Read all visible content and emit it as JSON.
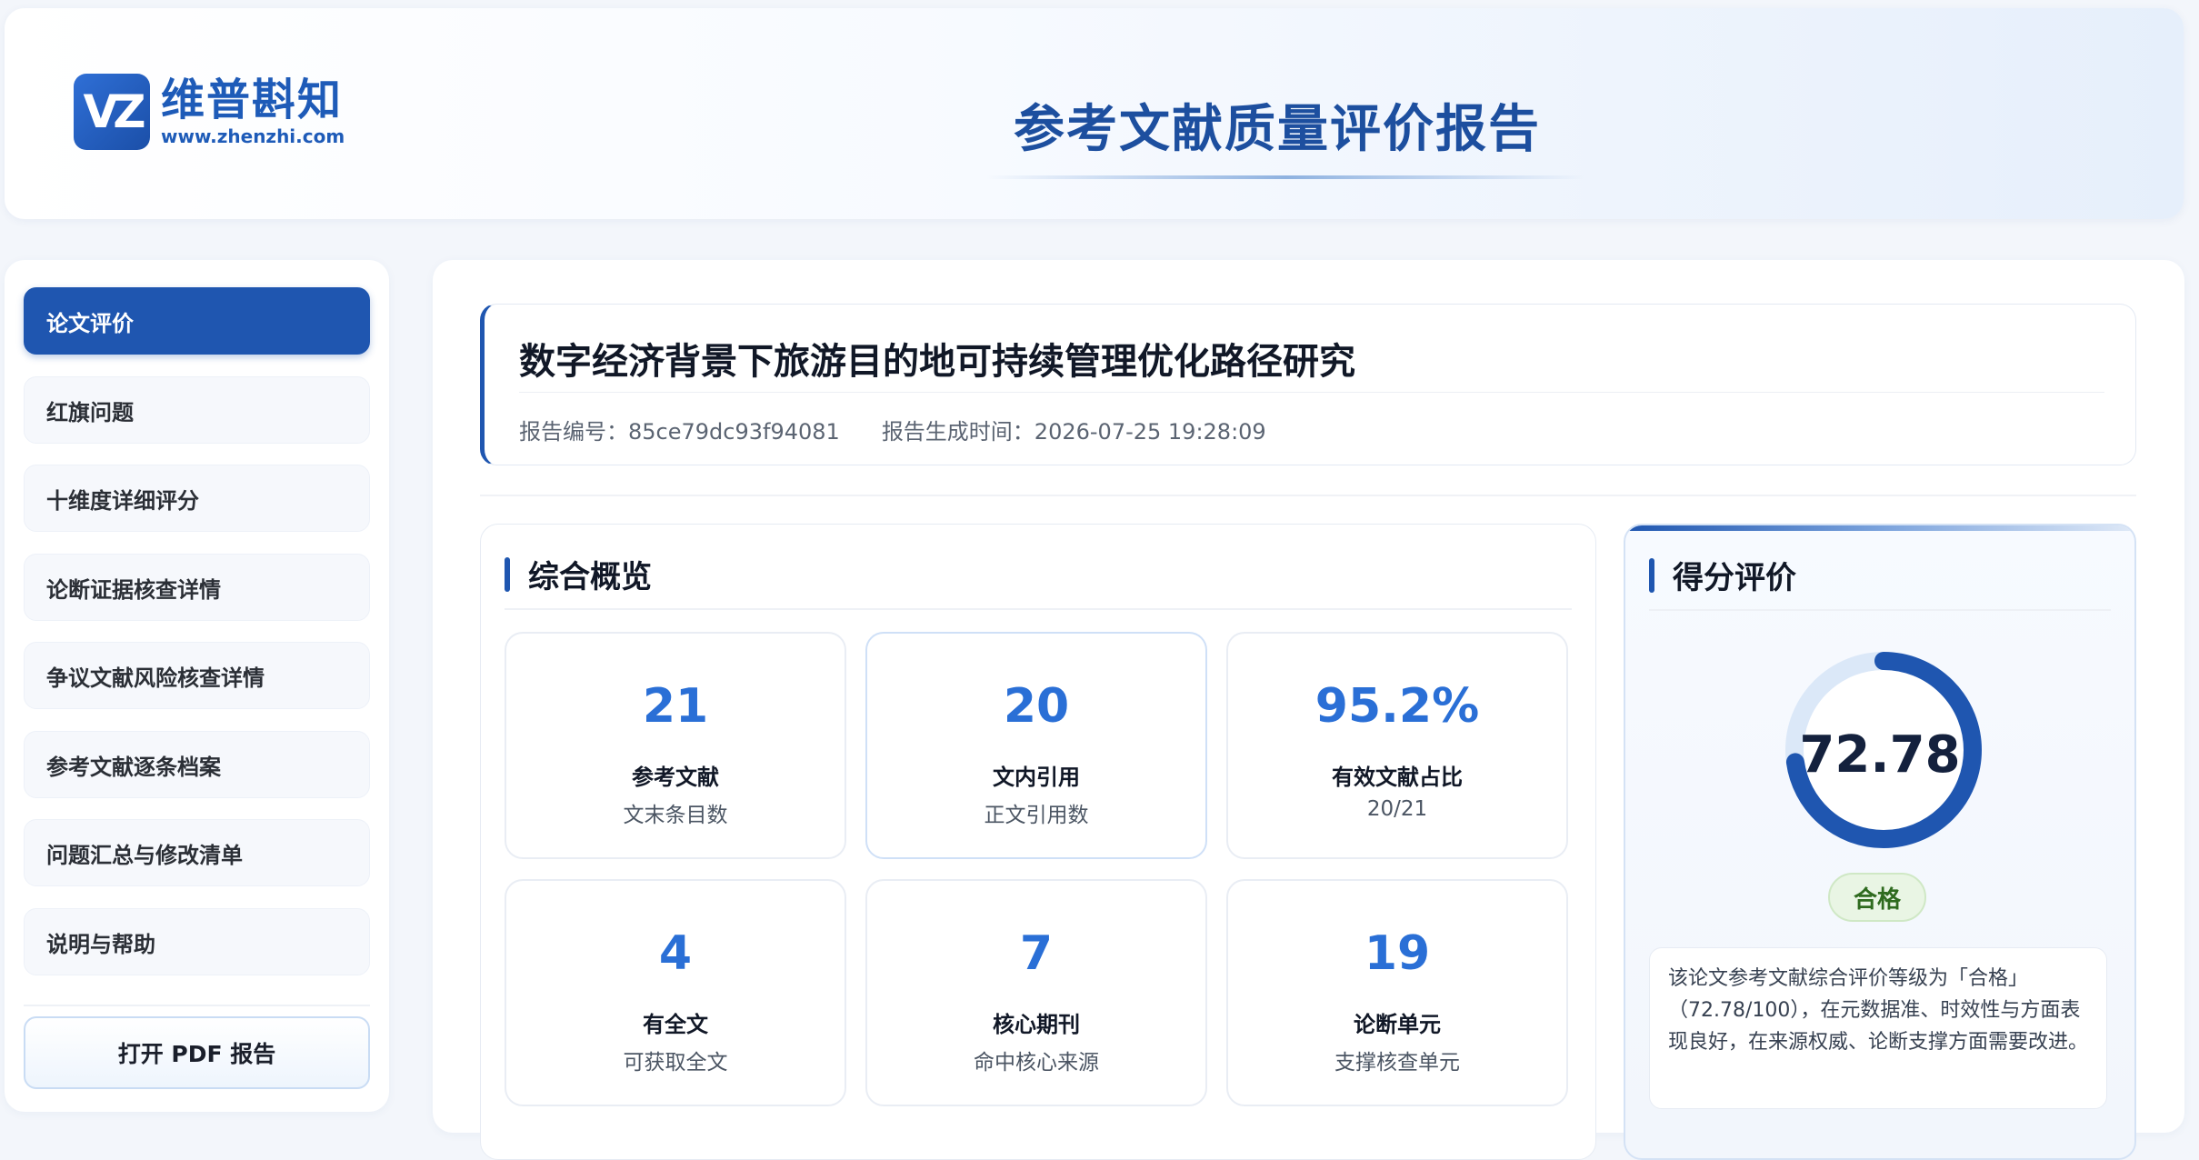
{
  "header": {
    "logo_mark": "VZ",
    "logo_name": "维普斟知",
    "logo_url": "www.zhenzhi.com",
    "title": "参考文献质量评价报告"
  },
  "sidebar": {
    "items": [
      {
        "label": "论文评价",
        "active": true
      },
      {
        "label": "红旗问题"
      },
      {
        "label": "十维度详细评分"
      },
      {
        "label": "论断证据核查详情"
      },
      {
        "label": "争议文献风险核查详情"
      },
      {
        "label": "参考文献逐条档案"
      },
      {
        "label": "问题汇总与修改清单"
      },
      {
        "label": "说明与帮助"
      }
    ],
    "pdf_button": "打开 PDF 报告"
  },
  "paper": {
    "title": "数字经济背景下旅游目的地可持续管理优化路径研究",
    "report_id": "报告编号：85ce79dc93f94081",
    "generated_at": "报告生成时间：2026-07-25 19:28:09"
  },
  "overview": {
    "title": "综合概览",
    "stats": [
      {
        "value": "21",
        "label": "参考文献",
        "sub": "文末条目数"
      },
      {
        "value": "20",
        "label": "文内引用",
        "sub": "正文引用数"
      },
      {
        "value": "95.2%",
        "label": "有效文献占比",
        "sub": "20/21"
      },
      {
        "value": "4",
        "label": "有全文",
        "sub": "可获取全文"
      },
      {
        "value": "7",
        "label": "核心期刊",
        "sub": "命中核心来源"
      },
      {
        "value": "19",
        "label": "论断单元",
        "sub": "支撑核查单元"
      }
    ]
  },
  "score": {
    "title": "得分评价",
    "value": "72.78",
    "fraction": 0.7278,
    "grade": "合格",
    "description": "该论文参考文献综合评价等级为「合格」（72.78/100），在元数据准、时效性与方面表现良好，在来源权威、论断支撑方面需要改进。",
    "colors": {
      "arc": "#1f56b0",
      "track": "#dbe8f8"
    }
  }
}
